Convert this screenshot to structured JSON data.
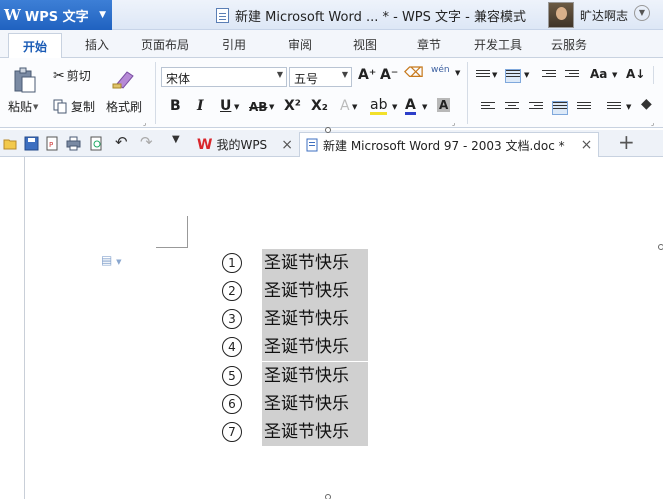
{
  "titlebar": {
    "app_logo": "W",
    "app_name": "WPS 文字",
    "document_title": "新建 Microsoft Word ... * - WPS 文字 - 兼容模式",
    "user_name": "旷达啊志"
  },
  "ribbon_tabs": [
    "开始",
    "插入",
    "页面布局",
    "引用",
    "审阅",
    "视图",
    "章节",
    "开发工具",
    "云服务"
  ],
  "ribbon": {
    "paste_label": "粘贴",
    "cut_label": "剪切",
    "copy_label": "复制",
    "format_painter_label": "格式刷",
    "font_name": "宋体",
    "font_size": "五号",
    "grow_font": "A⁺",
    "shrink_font": "A⁻",
    "phonetic": "wén",
    "bold": "B",
    "italic": "I",
    "underline": "U",
    "strike": "AB",
    "superscript": "X²",
    "subscript": "X₂",
    "text_effect": "A",
    "highlight": "ab",
    "font_color": "A",
    "char_shading": "A",
    "change_case": "Aa"
  },
  "quickbar": {
    "tabs": [
      {
        "label": "我的WPS",
        "close": "×"
      },
      {
        "label": "新建 Microsoft Word 97 - 2003 文档.doc *",
        "close": "×"
      }
    ],
    "new_tab": "+"
  },
  "document": {
    "list_items": [
      {
        "number": "1",
        "text": "圣诞节快乐"
      },
      {
        "number": "2",
        "text": "圣诞节快乐"
      },
      {
        "number": "3",
        "text": "圣诞节快乐"
      },
      {
        "number": "4",
        "text": "圣诞节快乐"
      },
      {
        "number": "5",
        "text": "圣诞节快乐"
      },
      {
        "number": "6",
        "text": "圣诞节快乐"
      },
      {
        "number": "7",
        "text": "圣诞节快乐"
      }
    ]
  },
  "colors": {
    "app_button": "#2062c0",
    "selection": "#d0d0d0",
    "active_tab_text": "#1a5bb5",
    "wps_red": "#d9262b"
  }
}
